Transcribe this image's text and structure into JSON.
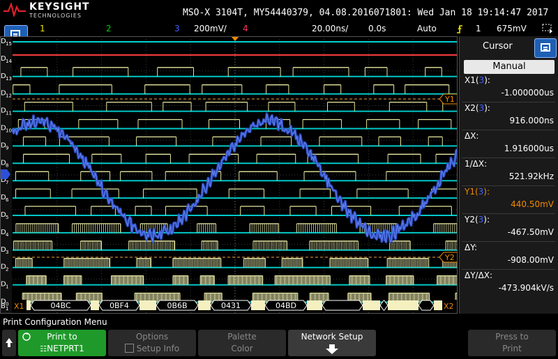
{
  "brand": {
    "name": "KEYSIGHT",
    "sub": "TECHNOLOGIES",
    "accent": "#e0202a"
  },
  "title_line": "MSO-X 3104T, MY54440379, 04.08.2016071801: Wed Jan 18 19:14:47 2017",
  "status": {
    "ch1": "1",
    "ch2": "2",
    "ch3": "3",
    "ch3_scale": "200mV/",
    "ch4": "4",
    "timebase": "20.00ns/",
    "delay": "0.0s",
    "trigger_mode": "Auto",
    "trigger_icon": "rising-edge-icon",
    "trigger_source": "1",
    "trigger_level": "675mV"
  },
  "colors": {
    "ch1": "#f0e000",
    "ch2": "#00d000",
    "ch3": "#4060ff",
    "ch4": "#ff3060",
    "digital": "#00c0c0",
    "ydata": "#e8e8a0",
    "cursor": "#f08a00"
  },
  "channel_labels": [
    "D15",
    "D14",
    "D13",
    "D12",
    "D11",
    "D10",
    "D9",
    "D8",
    "D7",
    "D6",
    "D5",
    "D4",
    "D3",
    "D2",
    "D1",
    "D0",
    "B1"
  ],
  "bus": {
    "start_marker": "X1",
    "end_marker": "X2",
    "values": [
      "04BC",
      "0BF4",
      "0B6B",
      "0431",
      "04BD"
    ]
  },
  "cursor_markers": {
    "y1": "Y1",
    "y2": "Y2"
  },
  "cursor_panel": {
    "title": "Cursor",
    "mode": "Manual",
    "rows": [
      {
        "label": "X1",
        "src": "3",
        "value": "-1.000000us"
      },
      {
        "label": "X2",
        "src": "3",
        "value": "916.000ns"
      },
      {
        "label": "ΔX:",
        "src": "",
        "value": "1.916000us"
      },
      {
        "label": "1/ΔX:",
        "src": "",
        "value": "521.92kHz"
      },
      {
        "label": "Y1",
        "src": "3",
        "value": "440.50mV"
      },
      {
        "label": "Y2",
        "src": "3",
        "value": "-467.50mV"
      },
      {
        "label": "ΔY:",
        "src": "",
        "value": "-908.00mV"
      },
      {
        "label": "ΔY/ΔX:",
        "src": "",
        "value": "-473.904kV/s"
      }
    ]
  },
  "softkeys": {
    "menu_title": "Print Configuration Menu",
    "print_to": {
      "label": "Print to",
      "value": "NETPRT1",
      "icon": "network-icon"
    },
    "options": {
      "label": "Options",
      "check_label": "Setup Info"
    },
    "palette": {
      "label": "Palette",
      "value": "Color"
    },
    "network": {
      "label": "Network Setup"
    },
    "press_to_print": {
      "label": "Press to",
      "value": "Print"
    }
  }
}
